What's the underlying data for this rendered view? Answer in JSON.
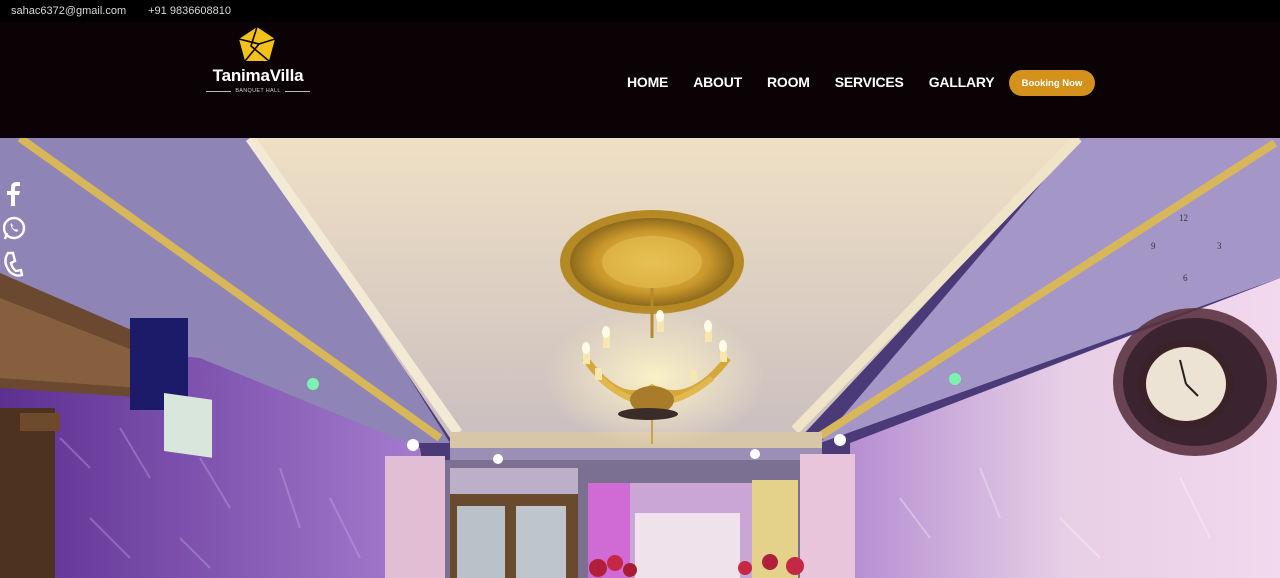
{
  "topbar": {
    "email": "sahac6372@gmail.com",
    "phone": "+91 9836608810"
  },
  "brand": {
    "name": "TanimaVilla",
    "tagline": "BANQUET HALL",
    "accent": "#f2c21b"
  },
  "nav": {
    "items": [
      "HOME",
      "ABOUT",
      "ROOM",
      "SERVICES",
      "GALLARY"
    ],
    "cta": "Booking Now",
    "cta_color": "#d4921c"
  },
  "hero": {
    "clock_numerals": [
      "12",
      "3",
      "6",
      "9"
    ]
  },
  "social": {
    "icons": [
      "facebook-icon",
      "whatsapp-icon",
      "phone-icon"
    ]
  }
}
